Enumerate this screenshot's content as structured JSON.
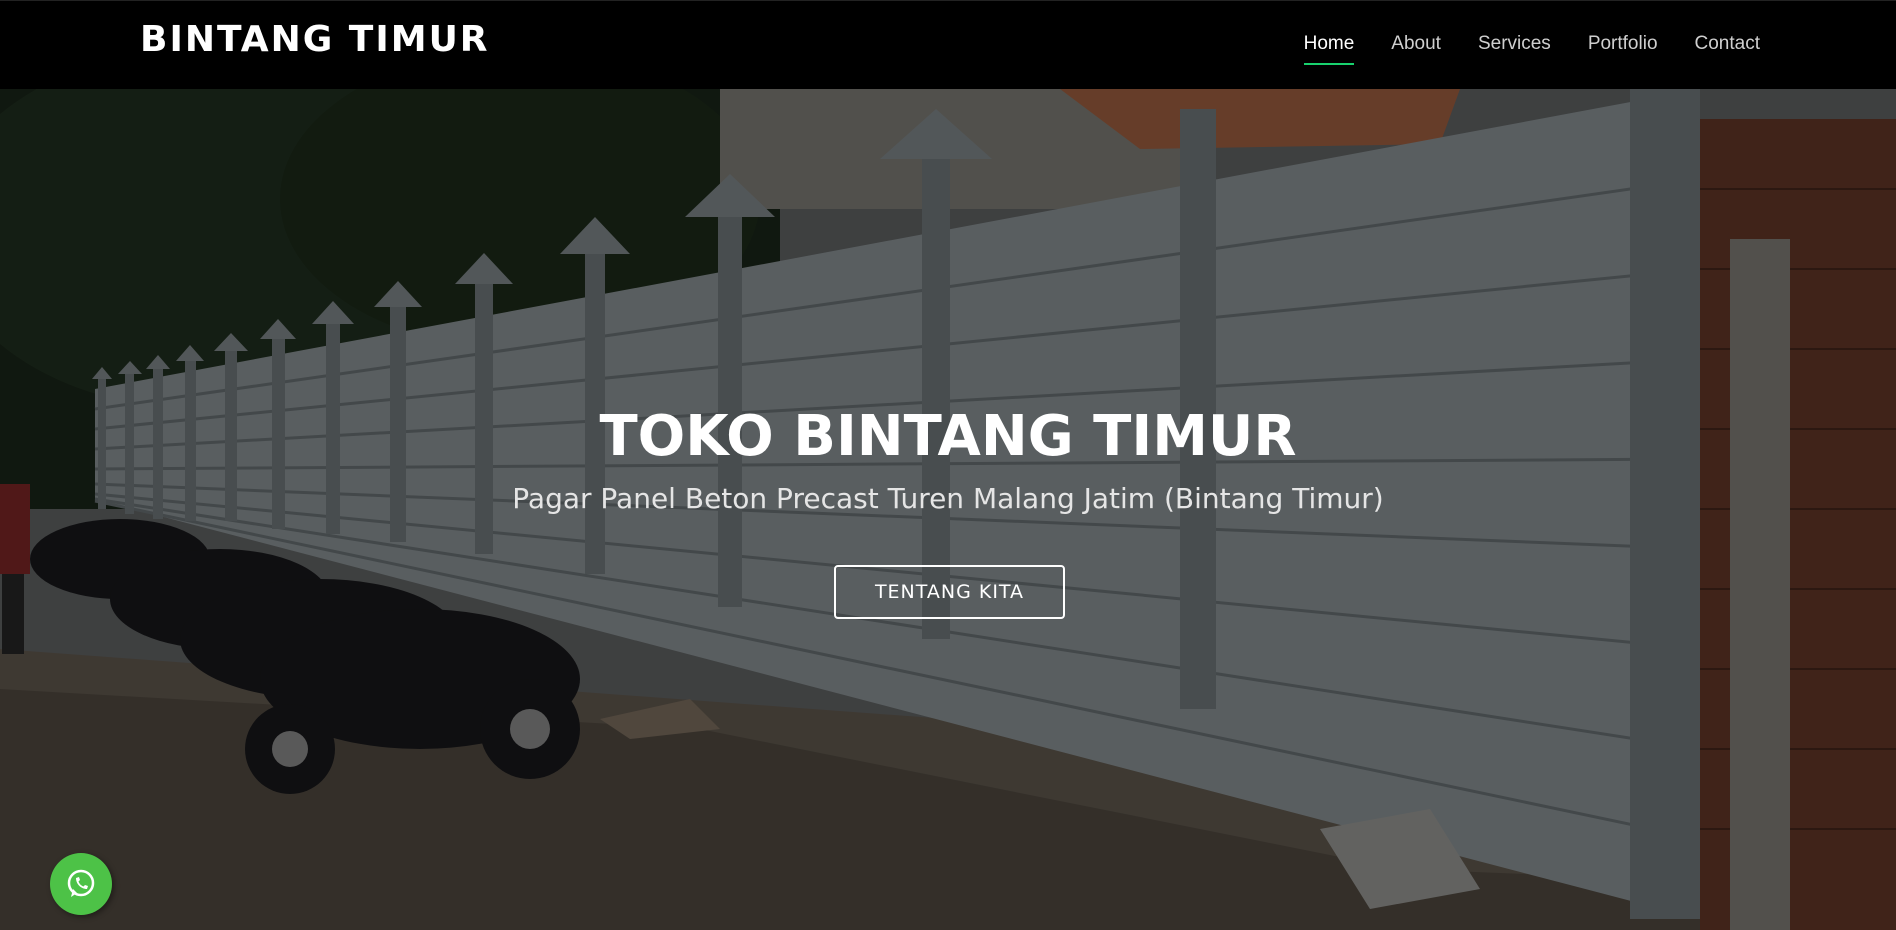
{
  "brand": {
    "name": "BINTANG TIMUR"
  },
  "nav": {
    "items": [
      {
        "label": "Home",
        "active": true
      },
      {
        "label": "About",
        "active": false
      },
      {
        "label": "Services",
        "active": false
      },
      {
        "label": "Portfolio",
        "active": false
      },
      {
        "label": "Contact",
        "active": false
      }
    ],
    "active_color": "#18d26e"
  },
  "hero": {
    "title": "TOKO BINTANG TIMUR",
    "subtitle": "Pagar Panel Beton Precast Turen Malang Jatim (Bintang Timur)",
    "button_label": "TENTANG KITA",
    "background_image": "concrete-panel-fence-with-parked-motorcycles"
  },
  "floating": {
    "icon": "whatsapp-icon",
    "color": "#4dc247"
  }
}
